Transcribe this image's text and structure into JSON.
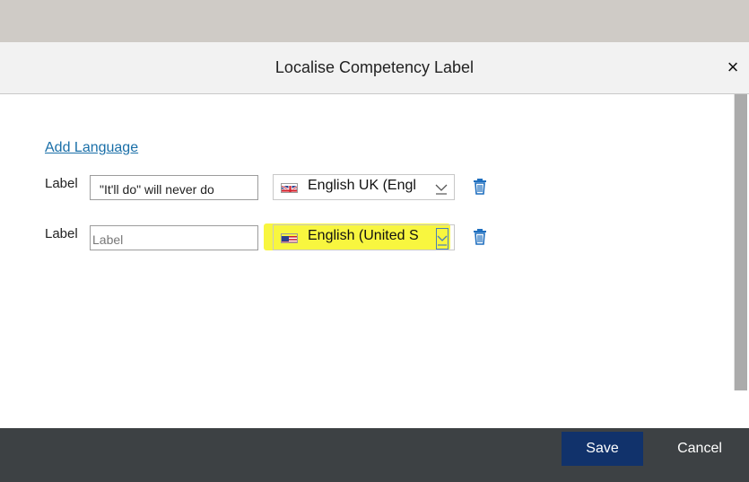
{
  "dialog": {
    "title": "Localise Competency Label",
    "close_label": "×"
  },
  "add_language_label": "Add Language",
  "rows": [
    {
      "label": "Label",
      "value": "\"It'll do\" will never do",
      "placeholder": "",
      "language": "English UK (Engl",
      "flag": "uk-flag-icon"
    },
    {
      "label": "Label",
      "value": "",
      "placeholder": "Label",
      "language": "English (United S",
      "flag": "us-flag-icon",
      "highlighted": true
    }
  ],
  "footer": {
    "save_label": "Save",
    "cancel_label": "Cancel"
  },
  "colors": {
    "link": "#1a6fa8",
    "save_button": "#11326b",
    "footer": "#3d4144",
    "highlight": "#f8f63f"
  }
}
